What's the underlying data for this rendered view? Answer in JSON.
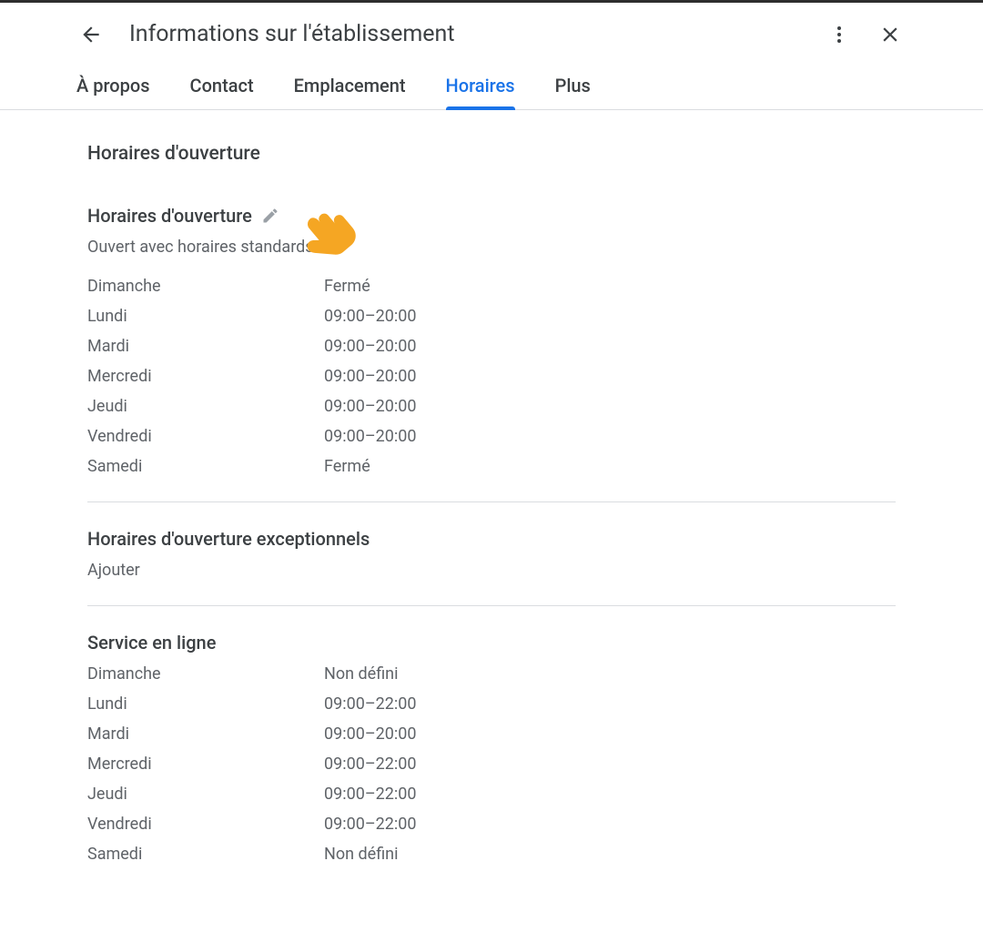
{
  "colors": {
    "accent": "#1a73e8",
    "pointer": "#f5a623"
  },
  "header": {
    "title": "Informations sur l'établissement",
    "back_icon": "arrow-left",
    "more_icon": "more-vertical",
    "close_icon": "close"
  },
  "tabs": [
    {
      "label": "À propos",
      "active": false
    },
    {
      "label": "Contact",
      "active": false
    },
    {
      "label": "Emplacement",
      "active": false
    },
    {
      "label": "Horaires",
      "active": true
    },
    {
      "label": "Plus",
      "active": false
    }
  ],
  "page": {
    "title": "Horaires d'ouverture"
  },
  "opening_hours": {
    "title": "Horaires d'ouverture",
    "status": "Ouvert avec horaires standards",
    "edit_icon": "pencil",
    "pointer_icon": "pointing-hand",
    "rows": [
      {
        "day": "Dimanche",
        "hours": "Fermé"
      },
      {
        "day": "Lundi",
        "hours": "09:00–20:00"
      },
      {
        "day": "Mardi",
        "hours": "09:00–20:00"
      },
      {
        "day": "Mercredi",
        "hours": "09:00–20:00"
      },
      {
        "day": "Jeudi",
        "hours": "09:00–20:00"
      },
      {
        "day": "Vendredi",
        "hours": "09:00–20:00"
      },
      {
        "day": "Samedi",
        "hours": "Fermé"
      }
    ]
  },
  "exceptional_hours": {
    "title": "Horaires d'ouverture exceptionnels",
    "add_label": "Ajouter"
  },
  "online_service": {
    "title": "Service en ligne",
    "rows": [
      {
        "day": "Dimanche",
        "hours": "Non défini"
      },
      {
        "day": "Lundi",
        "hours": "09:00–22:00"
      },
      {
        "day": "Mardi",
        "hours": "09:00–20:00"
      },
      {
        "day": "Mercredi",
        "hours": "09:00–22:00"
      },
      {
        "day": "Jeudi",
        "hours": "09:00–22:00"
      },
      {
        "day": "Vendredi",
        "hours": "09:00–22:00"
      },
      {
        "day": "Samedi",
        "hours": "Non défini"
      }
    ]
  }
}
